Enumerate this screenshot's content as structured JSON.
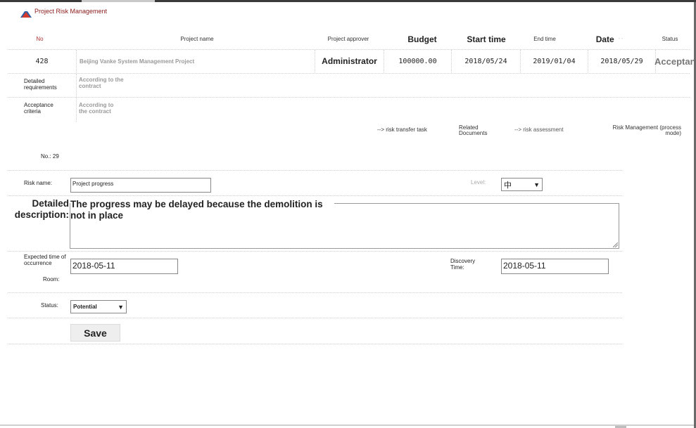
{
  "app": {
    "title": "Project Risk Management"
  },
  "project_table": {
    "headers": {
      "no": "No",
      "project_name": "Project name",
      "project_approver": "Project approver",
      "budget": "Budget",
      "start_time": "Start time",
      "end_time": "End time",
      "date": "Date",
      "date_suffix": "- -",
      "status": "Status"
    },
    "row": {
      "no": "428",
      "project_name": "Beijing Vanke System Management Project",
      "approver": "Administrator",
      "budget": "100000.00",
      "start_time": "2018/05/24",
      "end_time": "2019/01/04",
      "date": "2018/05/29",
      "status": "Acceptan"
    },
    "detailed_requirements": {
      "label": "Detailed requirements",
      "value": "According to the contract"
    },
    "acceptance_criteria": {
      "label": "Acceptance criteria",
      "value": "According to the contract"
    }
  },
  "links": {
    "risk_transfer_task": "--> risk transfer task",
    "related_documents": "Related Documents",
    "risk_assessment": "--> risk assessment",
    "risk_management": "Risk Management (process mode)"
  },
  "risk_form": {
    "no_label": "No.: 29",
    "risk_name": {
      "label": "Risk name:",
      "value": "Project progress"
    },
    "level": {
      "label": "Level:",
      "value": "中"
    },
    "detailed_description": {
      "label": "Detailed description:",
      "value": "The progress may be delayed because the demolition is not in place"
    },
    "expected_time": {
      "label": "Expected time of occurrence",
      "value": "2018-05-11"
    },
    "room": {
      "label": "Room:"
    },
    "discovery_time": {
      "label": "Discovery Time:",
      "value": "2018-05-11"
    },
    "status": {
      "label": "Status:",
      "value": "Potential"
    },
    "save_label": "Save"
  }
}
